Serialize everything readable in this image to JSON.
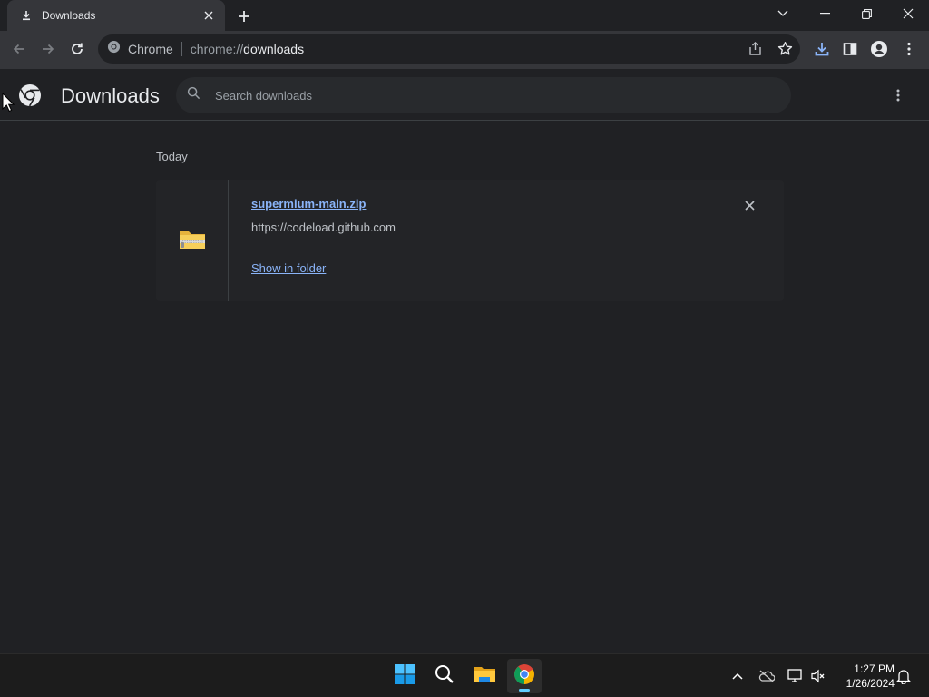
{
  "browser": {
    "tab": {
      "title": "Downloads",
      "icon": "download-icon"
    },
    "omnibox": {
      "site_label": "Chrome",
      "url_scheme": "chrome://",
      "url_host": "downloads"
    }
  },
  "page": {
    "title": "Downloads",
    "search": {
      "placeholder": "Search downloads"
    },
    "section_label": "Today",
    "downloads": [
      {
        "file_name": "supermium-main.zip",
        "source_url": "https://codeload.github.com",
        "action_label": "Show in folder",
        "icon": "zip-folder-icon"
      }
    ]
  },
  "taskbar": {
    "apps": [
      "start-icon",
      "search-icon",
      "file-explorer-icon",
      "chrome-icon"
    ],
    "clock": {
      "time": "1:27 PM",
      "date": "1/26/2024"
    }
  },
  "colors": {
    "background": "#202124",
    "toolbar": "#35363a",
    "link": "#8ab4f8",
    "taskbar_accent": "#60cdff"
  }
}
